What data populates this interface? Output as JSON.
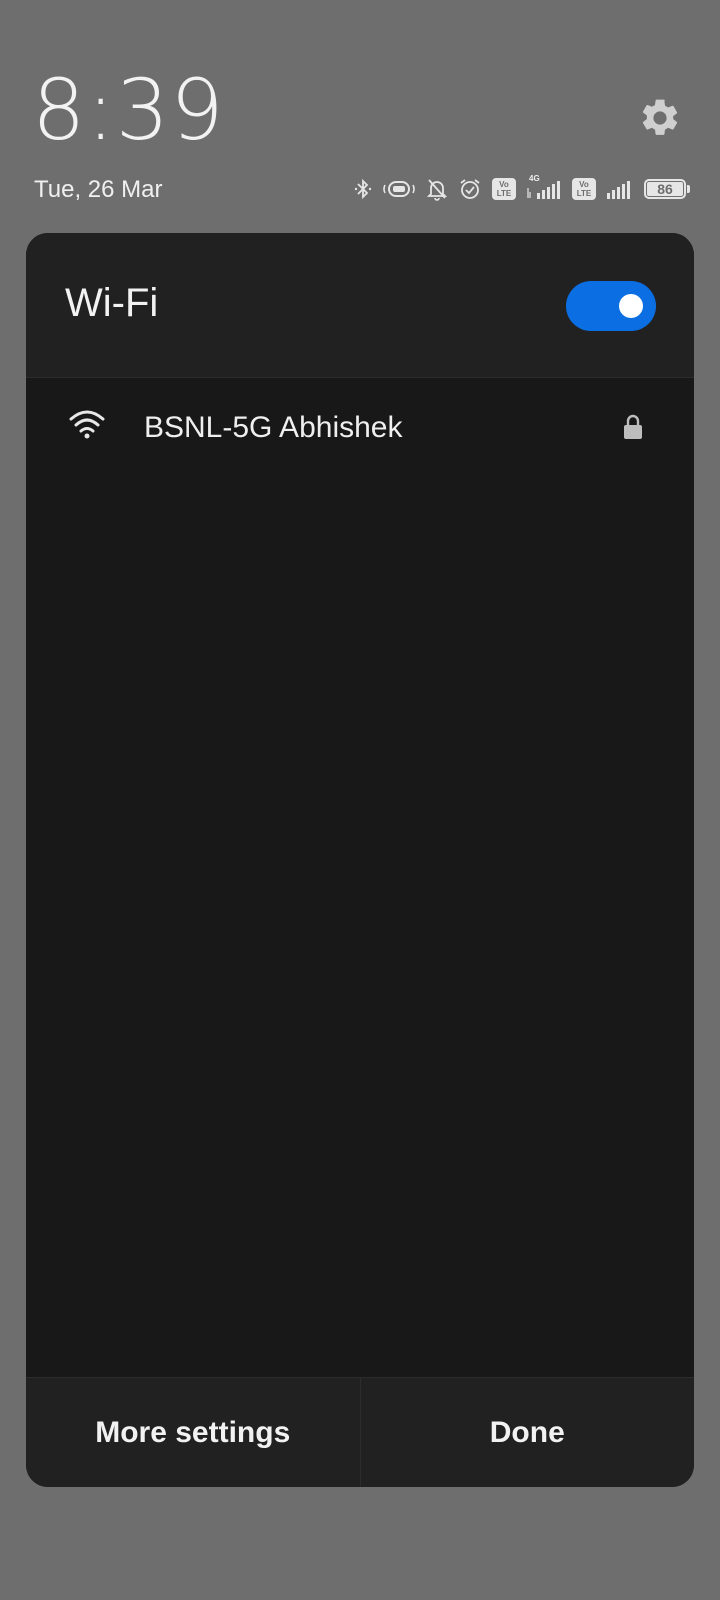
{
  "status": {
    "time": "8:39",
    "date": "Tue, 26 Mar",
    "battery_level": "86",
    "network_type": "4G",
    "volte_top": "Vo",
    "volte_bottom": "LTE",
    "icons": [
      "bluetooth-icon",
      "vibrate-icon",
      "bell-off-icon",
      "alarm-icon",
      "volte-icon",
      "signal-icon",
      "volte-icon",
      "signal-icon",
      "battery-icon"
    ]
  },
  "panel": {
    "title": "Wi-Fi",
    "toggle_on": true,
    "networks": [
      {
        "name": "BSNL-5G Abhishek",
        "secured": true
      }
    ],
    "more_settings_label": "More settings",
    "done_label": "Done"
  },
  "colors": {
    "accent": "#0b6fe3",
    "panel_bg": "#181818",
    "header_bg": "#212121",
    "backdrop": "#6e6e6e"
  }
}
